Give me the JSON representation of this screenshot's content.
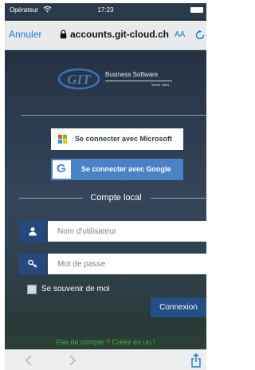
{
  "status_bar": {
    "carrier": "Opérateur",
    "time": "17:23"
  },
  "browser": {
    "cancel_label": "Annuler",
    "url": "accounts.git-cloud.ch",
    "aa_label": "AA",
    "icons": [
      "lock-icon",
      "reload-icon",
      "back-icon",
      "forward-icon",
      "share-icon"
    ]
  },
  "logo": {
    "emblem_text": "GIT",
    "main_text": "Business Software",
    "sub_text": "Since 1981"
  },
  "sso": {
    "microsoft_label": "Se connecter avec Microsoft",
    "google_label": "Se connecter avec Google",
    "google_glyph": "G"
  },
  "local": {
    "title": "Compte local",
    "username_placeholder": "Nom d'utilisateur",
    "password_placeholder": "Mot de passe",
    "remember_label": "Se souvenir de moi",
    "connect_label": "Connexion",
    "signup_text": "Pas de compte ? Créez en un !"
  },
  "colors": {
    "primary_blue": "#234f85",
    "google_blue": "#4a82c8",
    "link_green": "#38b84a",
    "safari_blue": "#1f7bd8"
  }
}
